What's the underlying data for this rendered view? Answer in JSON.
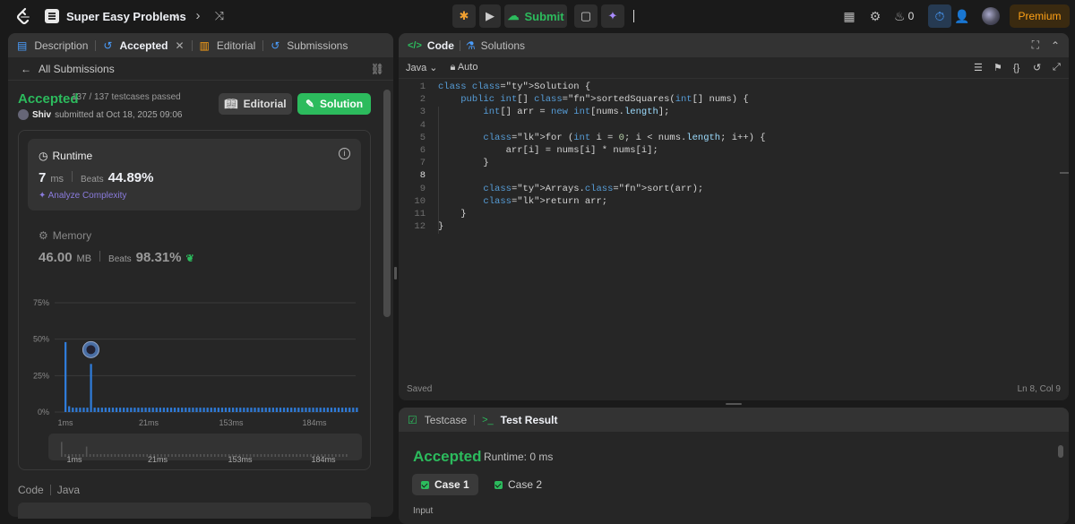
{
  "header": {
    "problem_list": "Super Easy Problems",
    "submit_label": "Submit",
    "streak_count": "0",
    "premium_label": "Premium"
  },
  "left_panel": {
    "tabs": [
      "Description",
      "Accepted",
      "Editorial",
      "Submissions"
    ],
    "back_label": "All Submissions",
    "status": "Accepted",
    "testcases": "137 / 137 testcases passed",
    "user": "Shiv",
    "submitted_at": "submitted at Oct 18, 2025 09:06",
    "editorial_btn": "Editorial",
    "solution_btn": "Solution",
    "runtime": {
      "label": "Runtime",
      "value": "7",
      "unit": "ms",
      "beats_label": "Beats",
      "beats": "44.89%",
      "analyze": "Analyze Complexity"
    },
    "memory": {
      "label": "Memory",
      "value": "46.00",
      "unit": "MB",
      "beats_label": "Beats",
      "beats": "98.31%"
    },
    "code_footer": {
      "label": "Code",
      "lang": "Java"
    }
  },
  "chart_data": {
    "type": "bar",
    "title": "",
    "ylabel": "",
    "yticks": [
      "75%",
      "50%",
      "25%",
      "0%"
    ],
    "xticks": [
      "1ms",
      "21ms",
      "153ms",
      "184ms"
    ],
    "ylim": [
      0,
      75
    ],
    "values": [
      48,
      4,
      3,
      3,
      3,
      3,
      3,
      33,
      3,
      3,
      3,
      3,
      3,
      3,
      3,
      3,
      3,
      3,
      3,
      3,
      3,
      3,
      3,
      3,
      3,
      3,
      3,
      3,
      3,
      3,
      3,
      3,
      3,
      3,
      3,
      3,
      3,
      3,
      3,
      3,
      3,
      3,
      3,
      3,
      3,
      3,
      3,
      3,
      3,
      3,
      3,
      3,
      3,
      3,
      3,
      3,
      3,
      3,
      3,
      3,
      3,
      3,
      3,
      3,
      3,
      3,
      3,
      3,
      3,
      3,
      3,
      3,
      3,
      3,
      3,
      3,
      3,
      3,
      3,
      3,
      3
    ],
    "user_bar_index": 7,
    "grid": true
  },
  "right_panel": {
    "tabs": [
      "Code",
      "Solutions"
    ],
    "language": "Java",
    "mode": "Auto",
    "code_lines": [
      "class Solution {",
      "    public int[] sortedSquares(int[] nums) {",
      "        int[] arr = new int[nums.length];",
      "",
      "        for (int i = 0; i < nums.length; i++) {",
      "            arr[i] = nums[i] * nums[i];",
      "        }",
      "",
      "        Arrays.sort(arr);",
      "        return arr;",
      "    }",
      "}"
    ],
    "status": "Saved",
    "cursor": "Ln 8, Col 9"
  },
  "test_panel": {
    "tabs": [
      "Testcase",
      "Test Result"
    ],
    "status": "Accepted",
    "runtime": "Runtime: 0 ms",
    "cases": [
      "Case 1",
      "Case 2"
    ],
    "input_label": "Input"
  }
}
